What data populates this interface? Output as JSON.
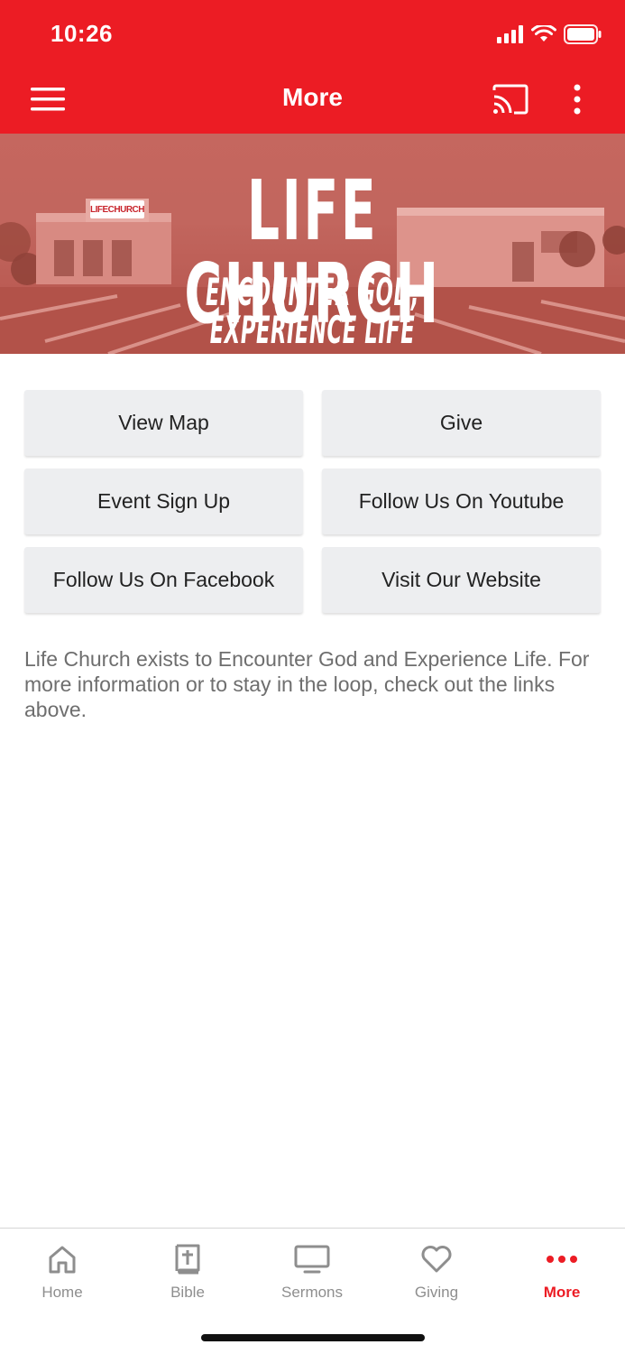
{
  "status": {
    "time": "10:26"
  },
  "nav": {
    "title": "More"
  },
  "banner": {
    "title": "LIFE CHURCH",
    "tagline": "ENCOUNTER GOD, EXPERIENCE LIFE",
    "sign_text": "LIFECHURCH"
  },
  "buttons": [
    {
      "label": "View Map"
    },
    {
      "label": "Give"
    },
    {
      "label": "Event Sign Up"
    },
    {
      "label": "Follow Us On Youtube"
    },
    {
      "label": "Follow Us On Facebook"
    },
    {
      "label": "Visit Our Website"
    }
  ],
  "description": "Life Church exists to Encounter God and Experience Life. For more information or to stay in the loop, check out the links above.",
  "tabs": [
    {
      "label": "Home",
      "icon": "home-icon"
    },
    {
      "label": "Bible",
      "icon": "bible-icon"
    },
    {
      "label": "Sermons",
      "icon": "monitor-icon"
    },
    {
      "label": "Giving",
      "icon": "heart-icon"
    },
    {
      "label": "More",
      "icon": "more-dots-icon"
    }
  ],
  "colors": {
    "brand": "#ec1c24",
    "button_bg": "#edeef0",
    "tab_inactive": "#8e8e8e"
  }
}
